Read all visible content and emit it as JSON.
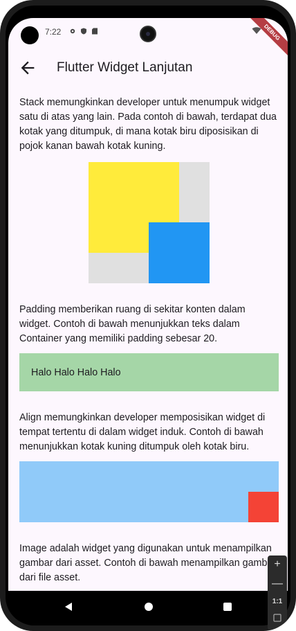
{
  "status_bar": {
    "time": "7:22",
    "debug_label": "DEBUG"
  },
  "app_bar": {
    "title": "Flutter Widget Lanjutan"
  },
  "sections": {
    "stack": {
      "description": "Stack memungkinkan developer untuk menumpuk widget satu di atas yang lain. Pada contoh di bawah, terdapat dua kotak yang ditumpuk, di mana kotak biru diposisikan di pojok kanan bawah kotak kuning.",
      "yellow_color": "#ffeb3b",
      "blue_color": "#2196f3",
      "background_color": "#e0e0e0"
    },
    "padding": {
      "description": "Padding memberikan ruang di sekitar konten dalam widget. Contoh di bawah menunjukkan teks dalam Container yang memiliki padding sebesar 20.",
      "sample_text": "Halo Halo Halo Halo",
      "background_color": "#a5d6a7"
    },
    "align": {
      "description": "Align memungkinkan developer memposisikan widget di tempat tertentu di dalam widget induk. Contoh di bawah menunjukkan kotak kuning ditumpuk oleh kotak biru.",
      "background_color": "#90caf9",
      "box_color": "#f44336"
    },
    "image": {
      "description": "Image adalah widget yang digunakan untuk menampilkan gambar dari asset. Contoh di bawah menampilkan gambar dari file asset."
    }
  },
  "nav_bar": {
    "icons": [
      "back-triangle-icon",
      "home-circle-icon",
      "recents-square-icon"
    ]
  },
  "emulator_toolbar": {
    "zoom_in": "+",
    "zoom_out": "—",
    "zoom_reset": "1:1"
  }
}
